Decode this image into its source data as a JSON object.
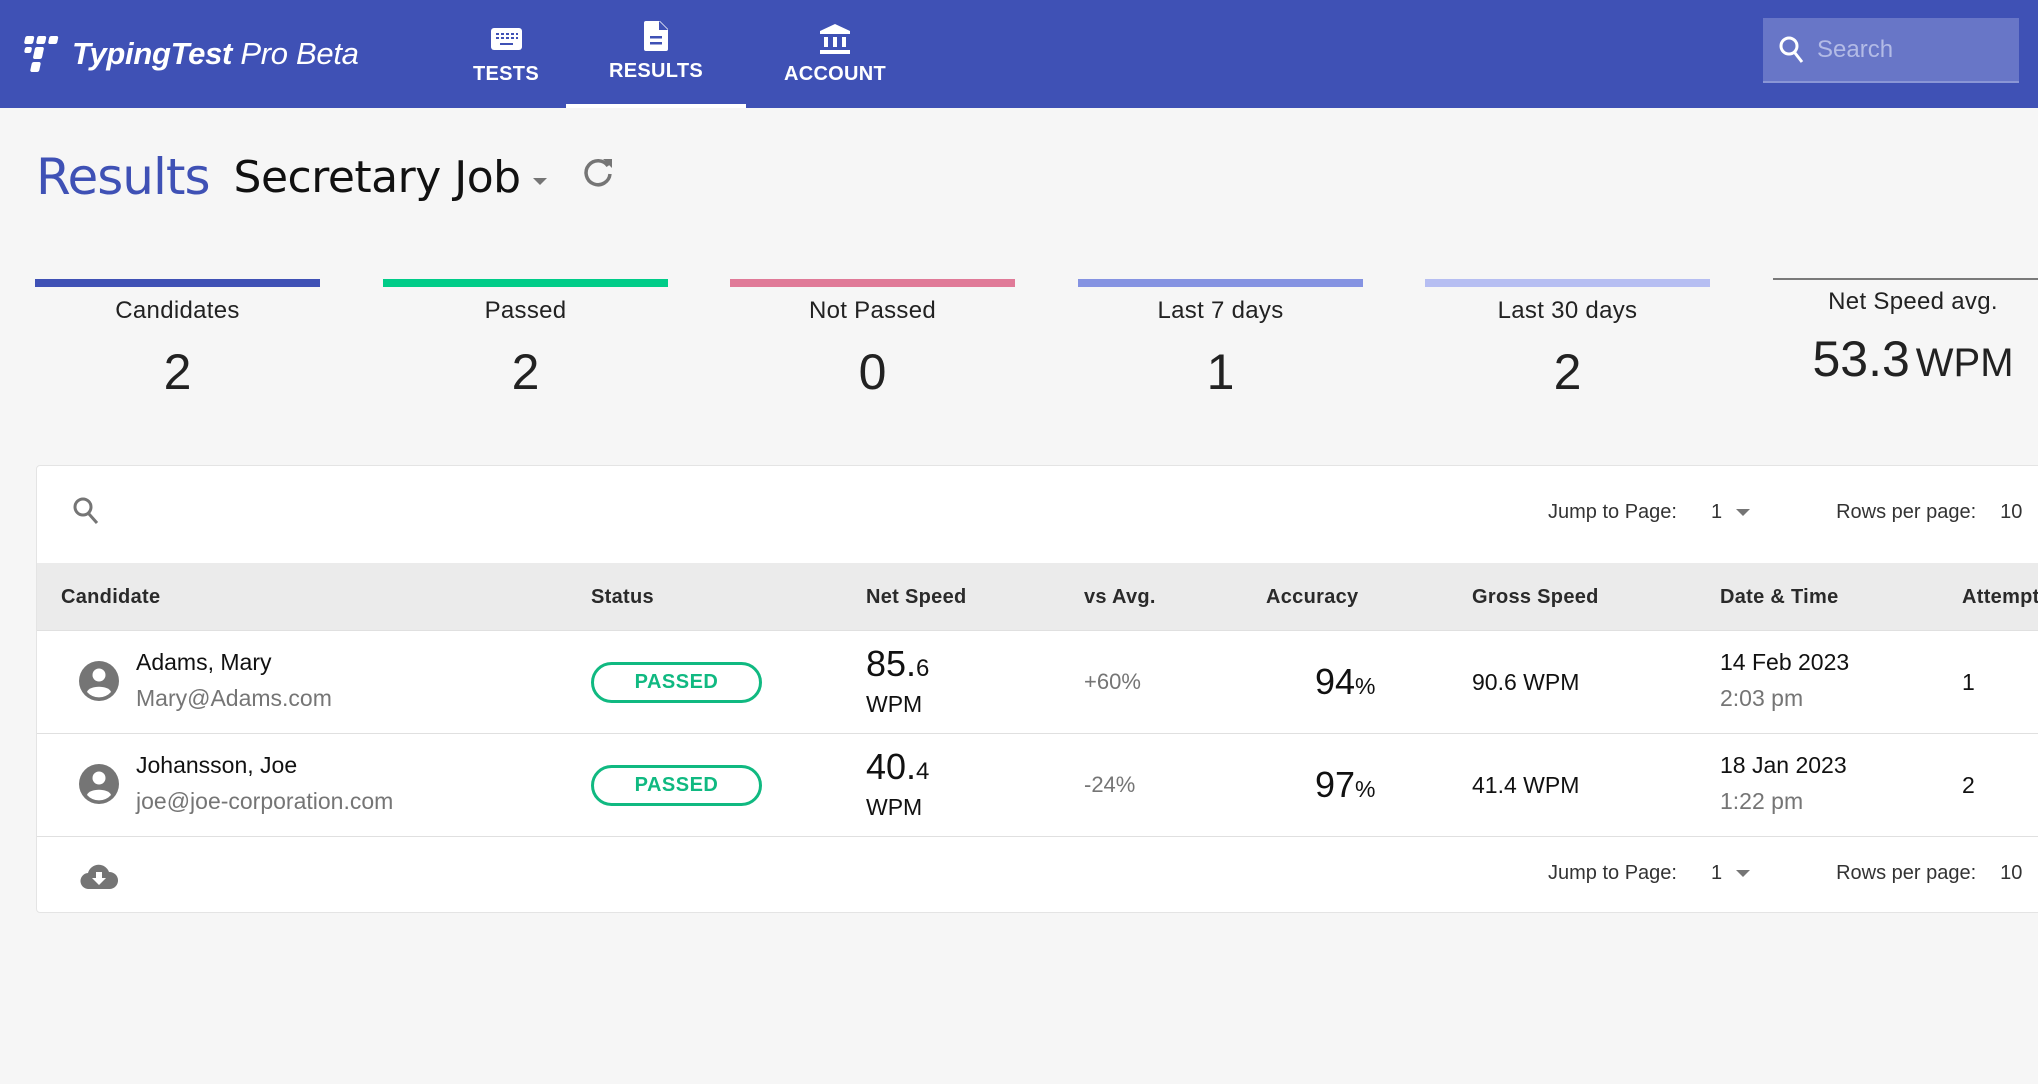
{
  "app": {
    "brand_bold": "TypingTest",
    "brand_rest": " Pro Beta"
  },
  "nav": {
    "tabs": [
      {
        "label": "TESTS",
        "icon": "keyboard-icon",
        "active": false
      },
      {
        "label": "RESULTS",
        "icon": "document-icon",
        "active": true
      },
      {
        "label": "ACCOUNT",
        "icon": "bank-icon",
        "active": false
      }
    ]
  },
  "search": {
    "placeholder": "Search",
    "value": ""
  },
  "page": {
    "title": "Results",
    "test_name": "Secretary Job"
  },
  "stats": [
    {
      "label": "Candidates",
      "value": "2",
      "color": "#3f51b5"
    },
    {
      "label": "Passed",
      "value": "2",
      "color": "#00cc88"
    },
    {
      "label": "Not Passed",
      "value": "0",
      "color": "#e07a98"
    },
    {
      "label": "Last 7 days",
      "value": "1",
      "color": "#8593e2"
    },
    {
      "label": "Last 30 days",
      "value": "2",
      "color": "#b6bef2"
    },
    {
      "label": "Net Speed avg.",
      "value": "53.3",
      "unit": "WPM"
    }
  ],
  "table": {
    "pager": {
      "jump_label": "Jump to Page:",
      "jump_value": "1",
      "rows_label": "Rows per page:",
      "rows_value": "10"
    },
    "columns": [
      "Candidate",
      "Status",
      "Net Speed",
      "vs Avg.",
      "Accuracy",
      "Gross Speed",
      "Date & Time",
      "Attempt"
    ],
    "rows": [
      {
        "name": "Adams, Mary",
        "email": "Mary@Adams.com",
        "status": "PASSED",
        "net_whole": "85.",
        "net_decimal": "6",
        "net_unit": "WPM",
        "vs_avg": "+60%",
        "accuracy": "94",
        "accuracy_unit": "%",
        "gross": "90.6 WPM",
        "date": "14 Feb 2023",
        "time": "2:03 pm",
        "attempt": "1"
      },
      {
        "name": "Johansson, Joe",
        "email": "joe@joe-corporation.com",
        "status": "PASSED",
        "net_whole": "40.",
        "net_decimal": "4",
        "net_unit": "WPM",
        "vs_avg": "-24%",
        "accuracy": "97",
        "accuracy_unit": "%",
        "gross": "41.4 WPM",
        "date": "18 Jan 2023",
        "time": "1:22 pm",
        "attempt": "2"
      }
    ]
  }
}
